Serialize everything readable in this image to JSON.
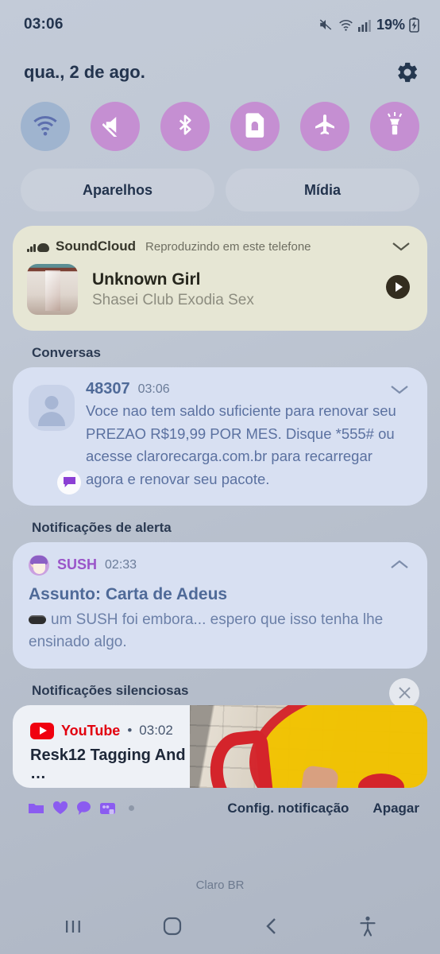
{
  "statusbar": {
    "time": "03:06",
    "battery_percent": "19%",
    "icons": [
      "mute-icon",
      "wifi-icon",
      "signal-icon",
      "battery-charging-icon"
    ]
  },
  "header": {
    "date": "qua., 2 de ago.",
    "settings_icon": "gear-icon"
  },
  "quick_toggles": [
    {
      "name": "wifi",
      "icon": "wifi-icon",
      "state": "off"
    },
    {
      "name": "sound",
      "icon": "mute-icon",
      "state": "on"
    },
    {
      "name": "bluetooth",
      "icon": "bluetooth-icon",
      "state": "on"
    },
    {
      "name": "sim-lock",
      "icon": "sim-card-icon",
      "state": "on"
    },
    {
      "name": "airplane-mode",
      "icon": "airplane-icon",
      "state": "on"
    },
    {
      "name": "flashlight",
      "icon": "flashlight-icon",
      "state": "on"
    }
  ],
  "pills": {
    "devices": "Aparelhos",
    "media": "Mídia"
  },
  "media_card": {
    "app": "SoundCloud",
    "subtitle": "Reproduzindo em este telefone",
    "track": "Unknown Girl",
    "artist": "Shasei Club Exodia Sex",
    "play_icon": "play-icon",
    "collapse_icon": "chevron-down-icon",
    "background": "#e6e6d4"
  },
  "sections": {
    "conversations": "Conversas",
    "alerts": "Notificações de alerta",
    "silent": "Notificações silenciosas"
  },
  "conversation": {
    "sender": "48307",
    "time": "03:06",
    "message": "Voce nao tem saldo suficiente para renovar seu PREZAO R$19,99 POR MES. Disque *555# ou acesse clarorecarga.com.br para recarregar agora e renovar seu pacote.",
    "collapse_icon": "chevron-down-icon",
    "badge_icon": "message-bubble-icon"
  },
  "alert": {
    "app": "SUSH",
    "time": "02:33",
    "title": "Assunto: Carta de Adeus",
    "body": "um SUSH foi embora... espero que isso tenha lhe ensinado algo.",
    "collapse_icon": "chevron-up-icon",
    "app_color": "#9a55c9"
  },
  "youtube": {
    "app": "YouTube",
    "separator": "•",
    "time": "03:02",
    "title": "Resk12 Tagging And …",
    "logo_color": "#f0000f"
  },
  "actions": {
    "app_icons": [
      "folder-icon",
      "heart-icon",
      "chat-bubble-icon",
      "gallery-icon"
    ],
    "settings_label": "Config. notificação",
    "clear_label": "Apagar",
    "close_icon": "close-icon"
  },
  "footer": {
    "carrier": "Claro BR"
  },
  "navbar": {
    "recents": "recents-icon",
    "home": "home-icon",
    "back": "back-icon",
    "accessibility": "accessibility-icon"
  }
}
